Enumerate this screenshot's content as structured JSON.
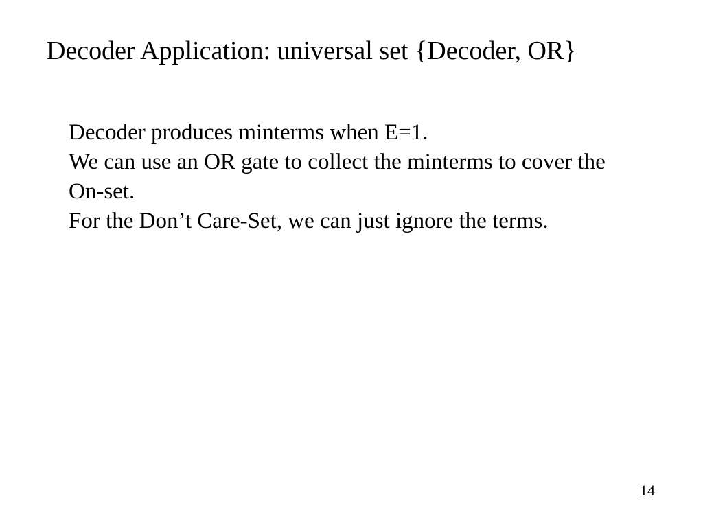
{
  "slide": {
    "title": "Decoder Application: universal set {Decoder, OR}",
    "body": {
      "line1": "Decoder produces minterms when E=1.",
      "line2": "We can use an OR gate to collect the minterms to cover the On-set.",
      "line3": "For the Don’t Care-Set, we can just ignore the terms."
    },
    "page_number": "14"
  }
}
